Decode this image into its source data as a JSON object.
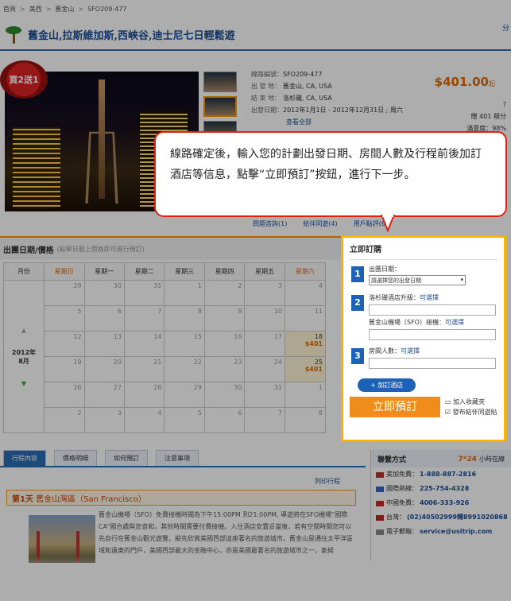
{
  "breadcrumb": {
    "home": "首頁",
    "sep": ">",
    "l1": "美西",
    "l2": "舊金山",
    "l3": "SFO209-477"
  },
  "title": "舊金山,拉斯維加斯,西峽谷,迪士尼七日輕鬆遊",
  "share": "分",
  "promo": "買2送1",
  "info": {
    "route_k": "線路編號：",
    "route_v": "SFO209-477",
    "dep_k": "出 發 地：",
    "dep_v": "舊金山, CA, USA",
    "end_k": "結 束 地：",
    "end_v": "洛杉磯, CA, USA",
    "date_k": "出發日期：",
    "date_v": "2012年1月1日 - 2012年12月31日 ; 周六",
    "view_all": "查看全部"
  },
  "price": {
    "value": "$401.00",
    "unit": "起"
  },
  "side": {
    "price_note": "?",
    "gift": "贈 401 積分",
    "satisfaction": "滿意度：",
    "sat_val": "98%"
  },
  "bubble": "線路確定後，輸入您的計劃出發日期、房間人數及行程前後加訂酒店等信息，點擊“立即預訂”按鈕，進行下一步。",
  "tabs_row": [
    "問題咨詢(1)",
    "結伴同遊(4)",
    "用戶點評(6)"
  ],
  "calendar": {
    "title": "出團日期/價格",
    "hint": "(點擊日曆上價格即可進行預訂)",
    "headers": [
      "月份",
      "星期日",
      "星期一",
      "星期二",
      "星期三",
      "星期四",
      "星期五",
      "星期六"
    ],
    "year": "2012年",
    "month": "8月",
    "rows": [
      [
        "29",
        "30",
        "31",
        "1",
        "2",
        "3",
        "4"
      ],
      [
        "5",
        "6",
        "7",
        "8",
        "9",
        "10",
        "11"
      ],
      [
        "12",
        "13",
        "14",
        "15",
        "16",
        "17",
        "18"
      ],
      [
        "19",
        "20",
        "21",
        "22",
        "23",
        "24",
        "25"
      ],
      [
        "26",
        "27",
        "28",
        "29",
        "30",
        "31",
        "1"
      ],
      [
        "2",
        "3",
        "4",
        "5",
        "6",
        "7",
        "8"
      ]
    ],
    "avail": [
      {
        "r": 2,
        "c": 6,
        "price": "$401"
      },
      {
        "r": 3,
        "c": 6,
        "price": "$401"
      }
    ]
  },
  "booking": {
    "title": "立即訂購",
    "s1_label": "出團日期：",
    "s1_select": "請選擇您的出發日期",
    "s2_label": "洛杉磯酒店升級：",
    "s2_opt": "可選擇",
    "s2b_label": "舊金山機場（SFO）接機：",
    "s2b_opt": "可選擇",
    "s3_label": "房間人數：",
    "s3_opt": "可選擇",
    "add_hotel": "+ 加訂酒店",
    "book_btn": "立即預訂",
    "fav": "加入收藏夾",
    "companion": "發布結伴同遊貼"
  },
  "lower_tabs": [
    "行程內容",
    "價格明細",
    "如何預訂",
    "注意事項"
  ],
  "print": "列印行程",
  "day1": {
    "label": "第1天",
    "title": "舊金山灣區（San Francisco）"
  },
  "day1_text": "舊金山機場（SFO）免費接機時間為下午15:00PM 到21:00PM, 導遊將在SFO機場“國際CA”國合處與您會和，其他時間需要付費接機。入住酒店安置妥當後，若有空閒時間您可以先自行在舊金山觀光遊覽，縱先欣賞美國西部這座著名的旅遊城市。舊金山是通往太平洋區域和遠東的門戶，美國西部最大的金融中心，亦是美國最著名的旅遊城市之一，氣候",
  "contact": {
    "title": "聯繫方式",
    "hours": "7*24",
    "hours_tail": "小時在線",
    "rows": [
      {
        "k": "美加免費：",
        "v": "1-888-887-2816",
        "flag": "#b33"
      },
      {
        "k": "國際熱線：",
        "v": "225-754-4328",
        "flag": "#36c"
      },
      {
        "k": "中國免費：",
        "v": "4006-333-926",
        "flag": "#d22"
      },
      {
        "k": "台灣：",
        "v": "(02)40502999轉8991020868",
        "flag": "#c22"
      },
      {
        "k": "電子郵箱：",
        "v": "service@usitrip.com",
        "flag": "#888"
      }
    ]
  }
}
